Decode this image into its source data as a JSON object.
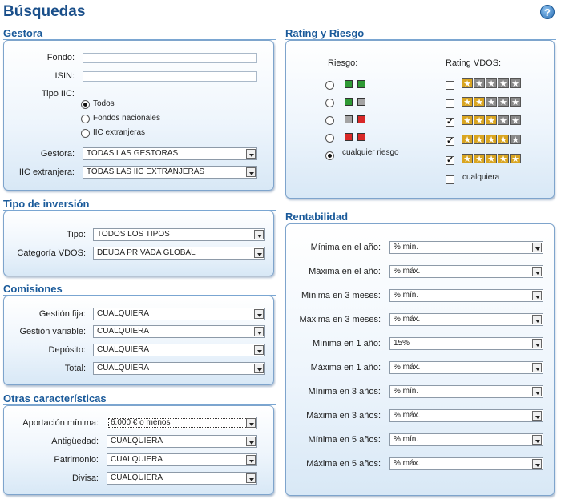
{
  "page": {
    "title": "Búsquedas",
    "help_icon": "?"
  },
  "gestora": {
    "title": "Gestora",
    "fondo_label": "Fondo:",
    "fondo_value": "",
    "isin_label": "ISIN:",
    "isin_value": "",
    "tipo_iic_label": "Tipo IIC:",
    "tipo_iic_options": [
      "Todos",
      "Fondos nacionales",
      "IIC extranjeras"
    ],
    "tipo_iic_selected": 0,
    "gestora_label": "Gestora:",
    "gestora_value": "TODAS LAS GESTORAS",
    "iic_extranjera_label": "IIC extranjera:",
    "iic_extranjera_value": "TODAS LAS IIC EXTRANJERAS"
  },
  "tipo_inversion": {
    "title": "Tipo de inversión",
    "tipo_label": "Tipo:",
    "tipo_value": "TODOS LOS TIPOS",
    "categoria_label": "Categoría VDOS:",
    "categoria_value": "DEUDA PRIVADA GLOBAL"
  },
  "comisiones": {
    "title": "Comisiones",
    "rows": [
      {
        "label": "Gestión fija:",
        "value": "CUALQUIERA"
      },
      {
        "label": "Gestión variable:",
        "value": "CUALQUIERA"
      },
      {
        "label": "Depósito:",
        "value": "CUALQUIERA"
      },
      {
        "label": "Total:",
        "value": "CUALQUIERA"
      }
    ]
  },
  "otras": {
    "title": "Otras características",
    "rows": [
      {
        "label": "Aportación mínima:",
        "value": "6.000 € o menos"
      },
      {
        "label": "Antigüedad:",
        "value": "CUALQUIERA"
      },
      {
        "label": "Patrimonio:",
        "value": "CUALQUIERA"
      },
      {
        "label": "Divisa:",
        "value": "CUALQUIERA"
      }
    ]
  },
  "rating": {
    "title": "Rating y Riesgo",
    "riesgo_header": "Riesgo:",
    "rating_header": "Rating VDOS:",
    "riesgo_options": [
      {
        "squares": [
          "green",
          "green"
        ],
        "selected": false
      },
      {
        "squares": [
          "green",
          "gray"
        ],
        "selected": false
      },
      {
        "squares": [
          "gray",
          "red"
        ],
        "selected": false
      },
      {
        "squares": [
          "red",
          "red"
        ],
        "selected": false
      },
      {
        "label": "cualquier riesgo",
        "selected": true
      }
    ],
    "rating_options": [
      {
        "stars": 1,
        "checked": false
      },
      {
        "stars": 2,
        "checked": false
      },
      {
        "stars": 3,
        "checked": true
      },
      {
        "stars": 4,
        "checked": true
      },
      {
        "stars": 5,
        "checked": true
      },
      {
        "label": "cualquiera",
        "checked": false
      }
    ],
    "colors": {
      "gold": "#d9a521",
      "grey": "#8a8a8a",
      "green": "#2f9a35",
      "red": "#d82828"
    }
  },
  "rentabilidad": {
    "title": "Rentabilidad",
    "rows": [
      {
        "label": "Mínima en el año:",
        "value": "% mín."
      },
      {
        "label": "Máxima en el año:",
        "value": "% máx."
      },
      {
        "label": "Mínima en 3 meses:",
        "value": "% mín."
      },
      {
        "label": "Máxima en 3 meses:",
        "value": "% máx."
      },
      {
        "label": "Mínima en 1 año:",
        "value": "15%"
      },
      {
        "label": "Máxima en 1 año:",
        "value": "% máx."
      },
      {
        "label": "Mínima en 3 años:",
        "value": "% mín."
      },
      {
        "label": "Máxima en 3 años:",
        "value": "% máx."
      },
      {
        "label": "Mínima en 5 años:",
        "value": "% mín."
      },
      {
        "label": "Máxima en 5 años:",
        "value": "% máx."
      }
    ]
  }
}
